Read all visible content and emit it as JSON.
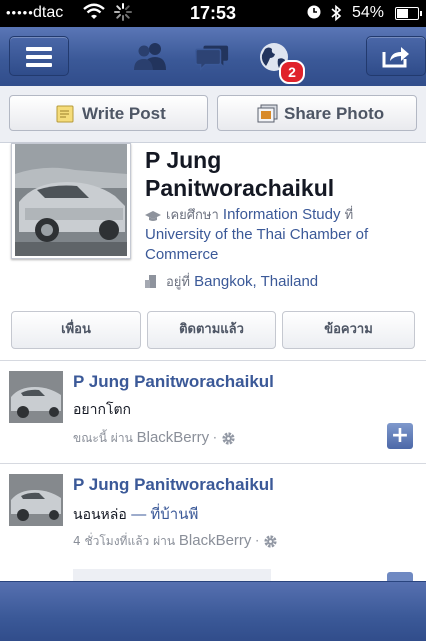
{
  "status_bar": {
    "signal": "•••••",
    "carrier": "dtac",
    "time": "17:53",
    "battery_percent_text": "54%",
    "battery_level": 0.54
  },
  "nav": {
    "notifications_count": "2",
    "accent_color": "#3b5998",
    "badge_color": "#e0232b"
  },
  "actions": {
    "write_post": "Write Post",
    "share_photo": "Share Photo"
  },
  "profile": {
    "name_line1": "P Jung",
    "name_line2": "Panitworachaikul",
    "study_prefix": "เคยศึกษา",
    "study_text": "Information Study",
    "study_at": "ที่",
    "school": "University of the Thai Chamber of Commerce",
    "lives_prefix": "อยู่ที่",
    "location": "Bangkok, Thailand",
    "buttons": [
      "เพื่อน",
      "ติดตามแล้ว",
      "ข้อความ"
    ]
  },
  "posts": [
    {
      "author": "P Jung Panitworachaikul",
      "text": "อยากโตก",
      "place": "",
      "time_prefix": "ขณะนี้ ผ่าน",
      "source": "BlackBerry",
      "dot": "·"
    },
    {
      "author": "P Jung Panitworachaikul",
      "text": "นอนหล่อ",
      "place": "— ที่บ้านพี",
      "time_prefix": "4 ชั่วโมงที่แล้ว ผ่าน",
      "source": "BlackBerry",
      "dot": "·"
    }
  ]
}
